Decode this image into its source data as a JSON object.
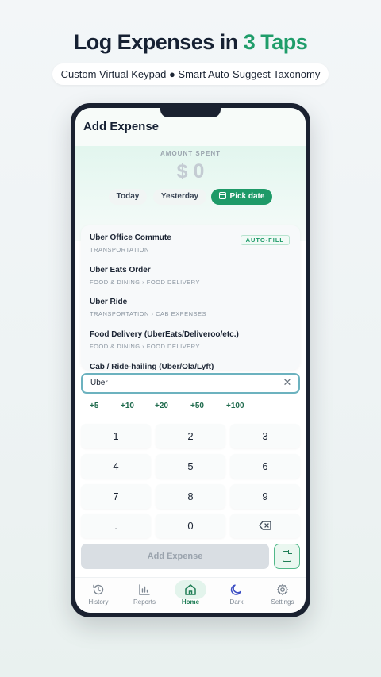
{
  "marketing": {
    "headline_main": "Log Expenses in ",
    "headline_accent": "3 Taps",
    "subtitle": "Custom Virtual Keypad ● Smart Auto-Suggest Taxonomy"
  },
  "header": {
    "title": "Add Expense"
  },
  "amount": {
    "label": "AMOUNT SPENT",
    "currency": "$",
    "value": "0"
  },
  "date_chips": {
    "today": "Today",
    "yesterday": "Yesterday",
    "pick": "Pick date"
  },
  "suggestions": [
    {
      "title": "Uber Office Commute",
      "category": "TRANSPORTATION",
      "badge": "AUTO-FILL"
    },
    {
      "title": "Uber Eats Order",
      "category": "FOOD & DINING › FOOD DELIVERY"
    },
    {
      "title": "Uber Ride",
      "category": "TRANSPORTATION › CAB EXPENSES"
    },
    {
      "title": "Food Delivery (UberEats/Deliveroo/etc.)",
      "category": "FOOD & DINING › FOOD DELIVERY"
    },
    {
      "title": "Cab / Ride-hailing (Uber/Ola/Lyft)",
      "category": ""
    }
  ],
  "search": {
    "value": "Uber"
  },
  "quick_add": [
    "+5",
    "+10",
    "+20",
    "+50",
    "+100"
  ],
  "keypad": [
    "1",
    "2",
    "3",
    "4",
    "5",
    "6",
    "7",
    "8",
    "9",
    ".",
    "0"
  ],
  "actions": {
    "add_expense": "Add Expense"
  },
  "nav": {
    "history": "History",
    "reports": "Reports",
    "home": "Home",
    "dark": "Dark",
    "settings": "Settings"
  },
  "colors": {
    "accent": "#1e9a68",
    "phone_frame": "#1a2130"
  },
  "icons": [
    "calendar-icon",
    "close-icon",
    "backspace-icon",
    "document-icon",
    "history-icon",
    "reports-icon",
    "home-icon",
    "moon-icon",
    "gear-icon"
  ]
}
